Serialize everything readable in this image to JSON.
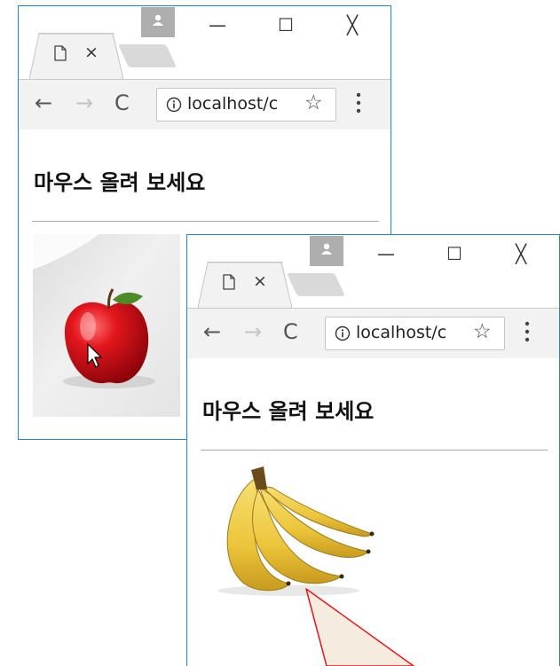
{
  "windows": [
    {
      "tab": {
        "close_label": "×"
      },
      "controls": {
        "minimize": "—",
        "maximize": "☐",
        "close": "╳"
      },
      "nav": {
        "back": "←",
        "forward": "→",
        "reload": "C"
      },
      "address": {
        "url": "localhost/c"
      },
      "page": {
        "heading": "마우스 올려 보세요",
        "image": "apple"
      }
    },
    {
      "tab": {
        "close_label": "×"
      },
      "controls": {
        "minimize": "—",
        "maximize": "☐",
        "close": "╳"
      },
      "nav": {
        "back": "←",
        "forward": "→",
        "reload": "C"
      },
      "address": {
        "url": "localhost/c"
      },
      "page": {
        "heading": "마우스 올려 보세요",
        "image": "banana"
      }
    }
  ],
  "colors": {
    "window_border": "#1a8ad6",
    "callout_stroke": "#e8161b",
    "callout_fill": "#f5ecdf",
    "apple": "#d8121c",
    "banana": "#f1cd45"
  },
  "icons": [
    "page-icon",
    "profile-icon",
    "info-icon",
    "star-icon",
    "menu-dots-icon",
    "mouse-cursor-icon"
  ]
}
